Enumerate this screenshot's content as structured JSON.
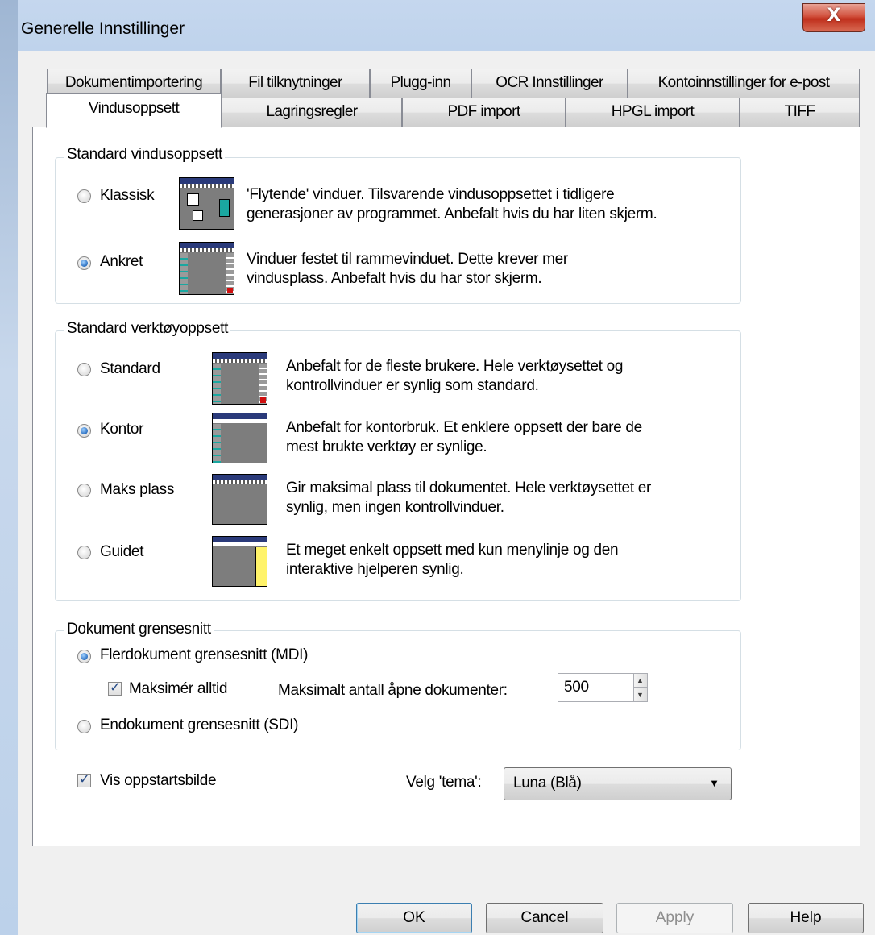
{
  "window": {
    "title": "Generelle Innstillinger",
    "close_glyph": "X"
  },
  "tabs": {
    "row1": [
      "Dokumentimportering",
      "Fil tilknytninger",
      "Plugg-inn",
      "OCR Innstillinger",
      "Kontoinnstillinger for e-post"
    ],
    "row2": [
      "Vindusoppsett",
      "Lagringsregler",
      "PDF import",
      "HPGL import",
      "TIFF"
    ],
    "active": "Vindusoppsett"
  },
  "window_layout": {
    "legend": "Standard vindusoppsett",
    "options": [
      {
        "label": "Klassisk",
        "checked": false,
        "desc1": "'Flytende' vinduer. Tilsvarende vindusoppsettet i tidligere",
        "desc2": "generasjoner av programmet. Anbefalt hvis du har liten skjerm."
      },
      {
        "label": "Ankret",
        "checked": true,
        "desc1": "Vinduer festet til rammevinduet. Dette krever mer",
        "desc2": "vindusplass. Anbefalt hvis du har stor skjerm."
      }
    ]
  },
  "tool_layout": {
    "legend": "Standard verktøyoppsett",
    "options": [
      {
        "label": "Standard",
        "checked": false,
        "desc1": "Anbefalt for de fleste brukere. Hele verktøysettet og",
        "desc2": "kontrollvinduer er synlig som standard."
      },
      {
        "label": "Kontor",
        "checked": true,
        "desc1": "Anbefalt for kontorbruk. Et enklere oppsett der bare de",
        "desc2": "mest brukte verktøy er synlige."
      },
      {
        "label": "Maks plass",
        "checked": false,
        "desc1": "Gir maksimal plass til dokumentet. Hele verktøysettet er",
        "desc2": "synlig, men ingen kontrollvinduer."
      },
      {
        "label": "Guidet",
        "checked": false,
        "desc1": "Et meget enkelt oppsett med kun menylinje og den",
        "desc2": "interaktive hjelperen synlig."
      }
    ]
  },
  "document_interface": {
    "legend": "Dokument grensesnitt",
    "mdi_label": "Flerdokument grensesnitt (MDI)",
    "mdi_checked": true,
    "maximize_label": "Maksimér alltid",
    "maximize_checked": true,
    "max_docs_label": "Maksimalt antall åpne dokumenter:",
    "max_docs_value": "500",
    "sdi_label": "Endokument grensesnitt (SDI)",
    "sdi_checked": false
  },
  "startup": {
    "show_splash_label": "Vis oppstartsbilde",
    "show_splash_checked": true
  },
  "theme": {
    "label": "Velg 'tema':",
    "value": "Luna (Blå)"
  },
  "buttons": {
    "ok": "OK",
    "cancel": "Cancel",
    "apply": "Apply",
    "help": "Help"
  },
  "glyphs": {
    "check": "✓",
    "dropdown": "▼",
    "spin_up": "▲",
    "spin_down": "▼"
  }
}
